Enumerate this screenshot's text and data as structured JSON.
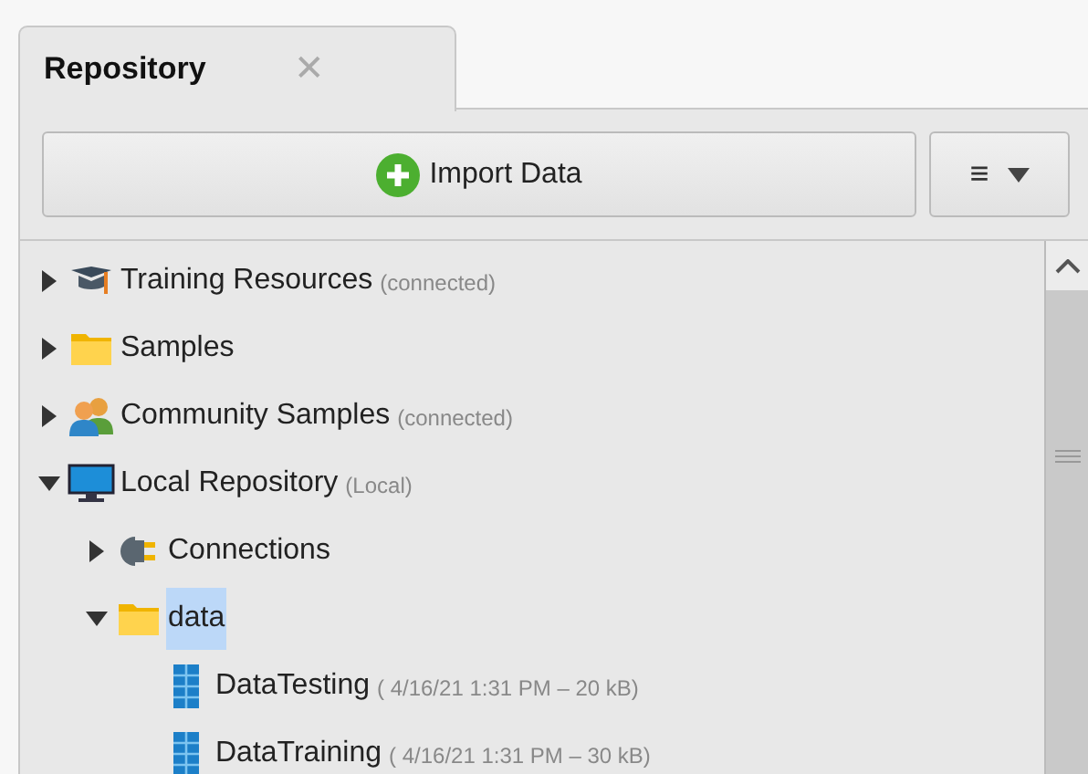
{
  "tab": {
    "title": "Repository",
    "close": "✕"
  },
  "toolbar": {
    "import_button": "Import Data",
    "menu_button": "≡"
  },
  "tree": [
    {
      "label": "Training Resources",
      "note": "(connected)",
      "kind": "training",
      "expanded": false,
      "selected": false
    },
    {
      "label": "Samples",
      "kind": "folder",
      "expanded": false,
      "selected": false
    },
    {
      "label": "Community Samples",
      "note": "(connected)",
      "kind": "community",
      "expanded": false,
      "selected": false
    },
    {
      "label": "Local Repository",
      "note": "(Local)",
      "kind": "monitor",
      "expanded": true,
      "selected": false,
      "children": [
        {
          "label": "Connections",
          "kind": "connections",
          "expanded": false,
          "selected": false
        },
        {
          "label": "data",
          "kind": "folder",
          "expanded": true,
          "selected": true,
          "children": [
            {
              "label": "DataTesting",
              "note": "( 4/16/21 1:31 PM – 20 kB)",
              "kind": "table",
              "selected": false
            },
            {
              "label": "DataTraining",
              "note": "( 4/16/21 1:31 PM – 30 kB)",
              "kind": "table",
              "selected": false
            }
          ]
        }
      ]
    }
  ]
}
